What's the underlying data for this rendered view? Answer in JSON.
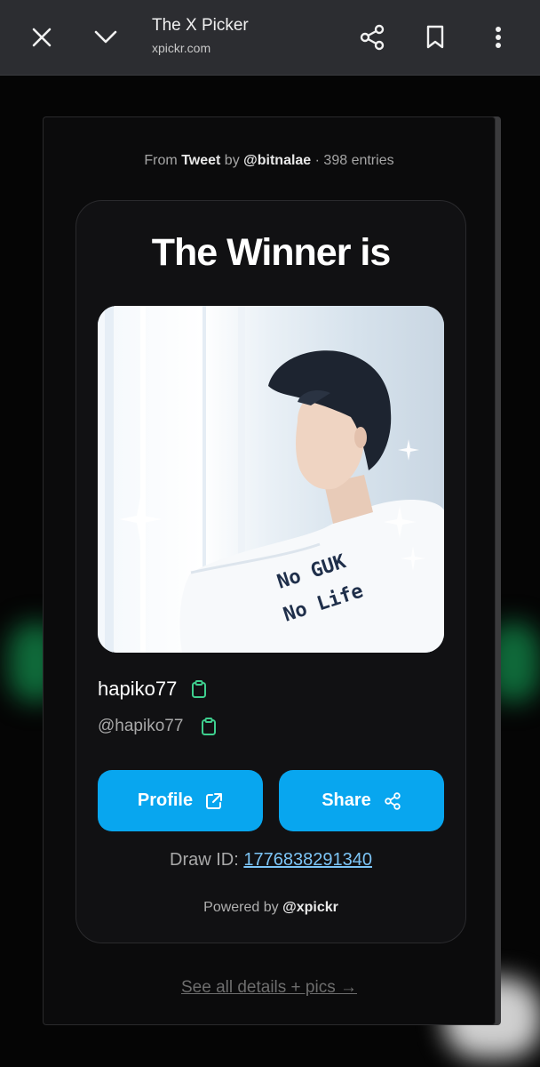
{
  "browser": {
    "title": "The X Picker",
    "url": "xpickr.com",
    "icons": [
      "close-icon",
      "chevron-down-icon",
      "share-icon",
      "bookmark-icon",
      "more-vert-icon"
    ]
  },
  "modal": {
    "from_prefix": "From ",
    "from_source": "Tweet",
    "from_by": " by ",
    "from_author": "@bitnalae",
    "from_entries": " · 398 entries",
    "heading": "The Winner is",
    "photo_text_line1": "No GUK",
    "photo_text_line2": "No Life",
    "winner_name": "hapiko77",
    "winner_handle": "@hapiko77",
    "profile_label": "Profile",
    "share_label": "Share",
    "draw_id_label": "Draw ID: ",
    "draw_id_value": "1776838291340",
    "powered_prefix": "Powered by ",
    "powered_brand": "@xpickr",
    "see_all": "See all details + pics →"
  },
  "colors": {
    "accent": "#08a6ef",
    "copy_icon": "#3ecf8e",
    "link": "#7cc4f5"
  }
}
